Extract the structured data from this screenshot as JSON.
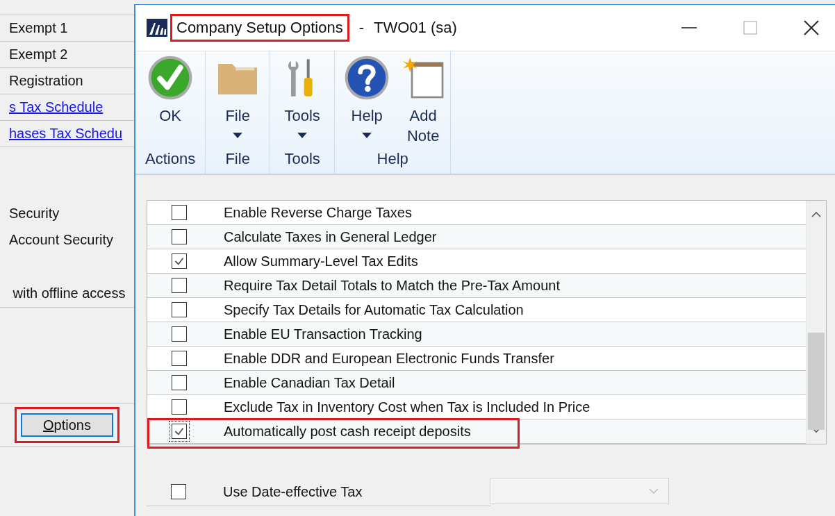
{
  "background_window": {
    "rows": [
      {
        "text": "Exempt 1",
        "kind": "text"
      },
      {
        "text": "Exempt 2",
        "kind": "text"
      },
      {
        "text": "Registration",
        "kind": "text"
      },
      {
        "text": "s Tax Schedule",
        "kind": "link"
      },
      {
        "text": "hases Tax Schedu",
        "kind": "link"
      }
    ],
    "settings": [
      {
        "text": "Security"
      },
      {
        "text": "Account Security"
      },
      {
        "text": " with offline access"
      }
    ],
    "options_button": "Options"
  },
  "window": {
    "title": "Company Setup Options",
    "separator": "-",
    "company": "TWO01 (sa)"
  },
  "ribbon": {
    "groups": [
      {
        "label": "Actions",
        "buttons": [
          {
            "label": "OK",
            "kind": "ok",
            "dropdown": false
          }
        ]
      },
      {
        "label": "File",
        "buttons": [
          {
            "label": "File",
            "kind": "folder",
            "dropdown": true
          }
        ]
      },
      {
        "label": "Tools",
        "buttons": [
          {
            "label": "Tools",
            "kind": "tools",
            "dropdown": true
          }
        ]
      },
      {
        "label": "Help",
        "buttons": [
          {
            "label": "Help",
            "kind": "help",
            "dropdown": true
          },
          {
            "label": "Add Note",
            "kind": "note",
            "dropdown": false
          }
        ]
      }
    ]
  },
  "options": [
    {
      "label": "Enable Reverse Charge Taxes",
      "checked": false,
      "focused": false
    },
    {
      "label": "Calculate Taxes in General Ledger",
      "checked": false,
      "focused": false
    },
    {
      "label": "Allow Summary-Level Tax Edits",
      "checked": true,
      "focused": false
    },
    {
      "label": "Require Tax Detail Totals to Match the Pre-Tax Amount",
      "checked": false,
      "focused": false
    },
    {
      "label": "Specify Tax Details for Automatic Tax Calculation",
      "checked": false,
      "focused": false
    },
    {
      "label": "Enable EU Transaction Tracking",
      "checked": false,
      "focused": false
    },
    {
      "label": "Enable DDR and European Electronic Funds Transfer",
      "checked": false,
      "focused": false
    },
    {
      "label": "Enable Canadian Tax Detail",
      "checked": false,
      "focused": false
    },
    {
      "label": "Exclude Tax in Inventory Cost when Tax is Included In Price",
      "checked": false,
      "focused": false
    },
    {
      "label": "Automatically post cash receipt deposits",
      "checked": true,
      "focused": true
    }
  ],
  "date_effective": {
    "label": "Use Date-effective Tax",
    "checked": false,
    "dropdown_disabled": true
  }
}
